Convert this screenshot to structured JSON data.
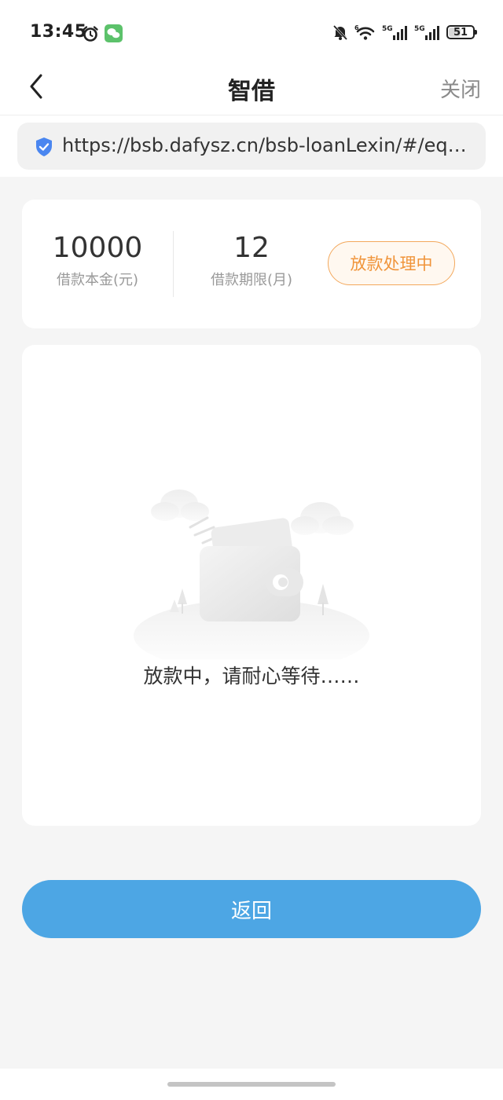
{
  "status_bar": {
    "time": "13:45",
    "battery": "51",
    "battery_level": 0.51,
    "icons": [
      "alarm-icon",
      "wechat-icon",
      "mute-icon",
      "wifi-icon",
      "signal-5g-icon",
      "signal-5g-icon",
      "battery-icon"
    ],
    "network_labels": [
      "5G",
      "5G"
    ],
    "wifi_label": "6"
  },
  "nav": {
    "title": "智借",
    "close_label": "关闭",
    "back_icon": "chevron-left-icon"
  },
  "url_bar": {
    "url": "https://bsb.dafysz.cn/bsb-loanLexin/#/equ...",
    "security_icon": "shield-check-icon",
    "accent": "#4a86f0"
  },
  "loan_summary": {
    "principal_value": "10000",
    "principal_label": "借款本金(元)",
    "term_value": "12",
    "term_label": "借款期限(月)",
    "status": "放款处理中",
    "status_color": "#f0943a"
  },
  "progress": {
    "illustration": "wallet-illustration",
    "message": "放款中，请耐心等待……"
  },
  "actions": {
    "return_label": "返回",
    "return_color": "#4da6e4"
  }
}
